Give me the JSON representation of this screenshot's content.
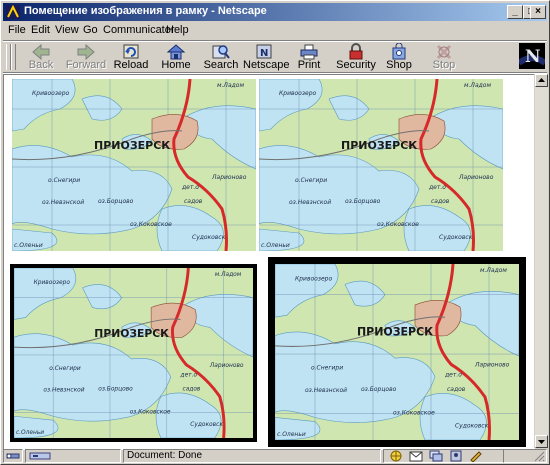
{
  "window": {
    "title": "Помещение изображения в рамку - Netscape",
    "buttons": {
      "minimize": "_",
      "maximize": "□",
      "close": "×"
    }
  },
  "menu": [
    {
      "label": "File",
      "key": "F"
    },
    {
      "label": "Edit",
      "key": "E"
    },
    {
      "label": "View",
      "key": "V"
    },
    {
      "label": "Go",
      "key": "G"
    },
    {
      "label": "Communicator",
      "key": "C"
    },
    {
      "label": "Help",
      "key": "H"
    }
  ],
  "toolbar": {
    "back": "Back",
    "forward": "Forward",
    "reload": "Reload",
    "home": "Home",
    "search": "Search",
    "netscape": "Netscape",
    "print": "Print",
    "security": "Security",
    "shop": "Shop",
    "stop": "Stop",
    "logo_letter": "N"
  },
  "map_labels": {
    "town": "ПРИОЗЕРСК",
    "nw": "Кривоозеро",
    "ne": "м.Ладом",
    "w1": "о.Снегири",
    "w2": "оз.Невзнской",
    "c1": "дет.о",
    "c2": "садов",
    "e": "Ларионово",
    "sw1": "оз.Борцово",
    "sw2": "оз.Коковское",
    "s": "с.Оленьи",
    "se": "Судоковск"
  },
  "status": {
    "text": "Document: Done"
  },
  "colors": {
    "title_start": "#0a246a",
    "title_end": "#a6caf0",
    "water": "#bfe3f2",
    "land": "#cfe6b0",
    "road": "#d62a2a",
    "frame": "#000000"
  }
}
